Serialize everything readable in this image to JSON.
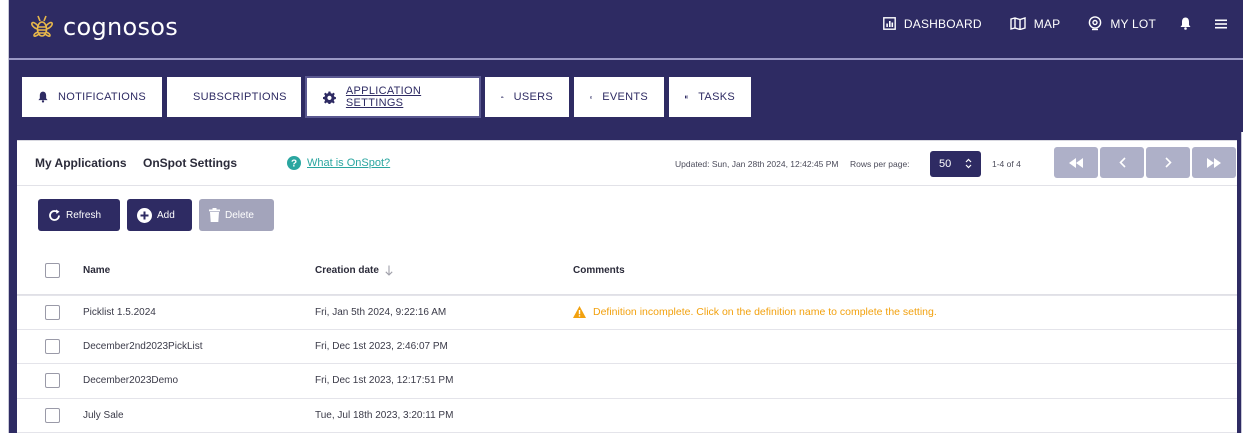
{
  "app": {
    "logo_text": "cognosos"
  },
  "nav": {
    "dashboard_label": "DASHBOARD",
    "map_label": "MAP",
    "mylot_label": "MY LOT"
  },
  "tabs": [
    {
      "label": "NOTIFICATIONS",
      "icon": "bell-icon",
      "active": false
    },
    {
      "label": "SUBSCRIPTIONS",
      "icon": "envelope-icon",
      "active": false
    },
    {
      "label": "APPLICATION SETTINGS",
      "icon": "gear-icon",
      "active": true
    },
    {
      "label": "USERS",
      "icon": "users-icon",
      "active": false
    },
    {
      "label": "EVENTS",
      "icon": "calendar-icon",
      "active": false
    },
    {
      "label": "TASKS",
      "icon": "tasks-icon",
      "active": false
    }
  ],
  "subheader": {
    "my_applications": "My Applications",
    "onspot_settings": "OnSpot Settings",
    "help_link": "What is OnSpot?",
    "updated": "Updated: Sun, Jan 28th 2024, 12:42:45 PM",
    "rows_per_page_label": "Rows per page:",
    "rows_per_page_value": "50",
    "range": "1-4 of 4"
  },
  "actions": {
    "refresh_label": "Refresh",
    "add_label": "Add",
    "delete_label": "Delete"
  },
  "table": {
    "columns": [
      "Name",
      "Creation date",
      "Comments"
    ],
    "rows": [
      {
        "name": "Picklist 1.5.2024",
        "created": "Fri, Jan 5th 2024, 9:22:16 AM",
        "comment": "Definition incomplete. Click on the definition name to complete the setting."
      },
      {
        "name": "December2nd2023PickList",
        "created": "Fri, Dec 1st 2023, 2:46:07 PM",
        "comment": ""
      },
      {
        "name": "December2023Demo",
        "created": "Fri, Dec 1st 2023, 12:17:51 PM",
        "comment": ""
      },
      {
        "name": "July Sale",
        "created": "Tue, Jul 18th 2023, 3:20:11 PM",
        "comment": ""
      }
    ]
  },
  "colors": {
    "brand": "#2e2b63",
    "warning": "#f2a10e",
    "link": "#2aa6a0",
    "pager_disabled": "#aeb0c8"
  }
}
